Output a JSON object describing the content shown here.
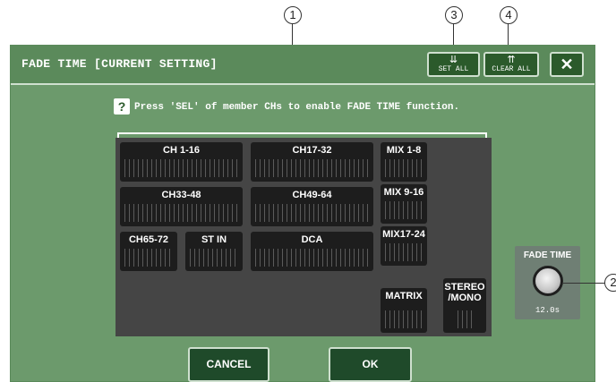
{
  "callouts": {
    "c1": "1",
    "c2": "2",
    "c3": "3",
    "c4": "4"
  },
  "window": {
    "title": "FADE TIME [CURRENT SETTING]"
  },
  "toolbar": {
    "set_all": "SET ALL",
    "clear_all": "CLEAR ALL",
    "close": "✕"
  },
  "hint": {
    "icon": "?",
    "text": "Press 'SEL' of member CHs to enable FADE TIME function."
  },
  "groups": {
    "ch1_16": "CH 1-16",
    "ch17_32": "CH17-32",
    "ch33_48": "CH33-48",
    "ch49_64": "CH49-64",
    "ch65_72": "CH65-72",
    "stin": "ST IN",
    "dca": "DCA",
    "mix1_8": "MIX 1-8",
    "mix9_16": "MIX 9-16",
    "mix17_24": "MIX17-24",
    "matrix": "MATRIX",
    "stereo_l1": "STEREO",
    "stereo_l2": "/MONO"
  },
  "fade_time": {
    "label": "FADE TIME",
    "value": "12.0s"
  },
  "buttons": {
    "cancel": "CANCEL",
    "ok": "OK"
  },
  "icons": {
    "question": "question-icon",
    "close": "close-icon",
    "knob": "knob-icon"
  }
}
